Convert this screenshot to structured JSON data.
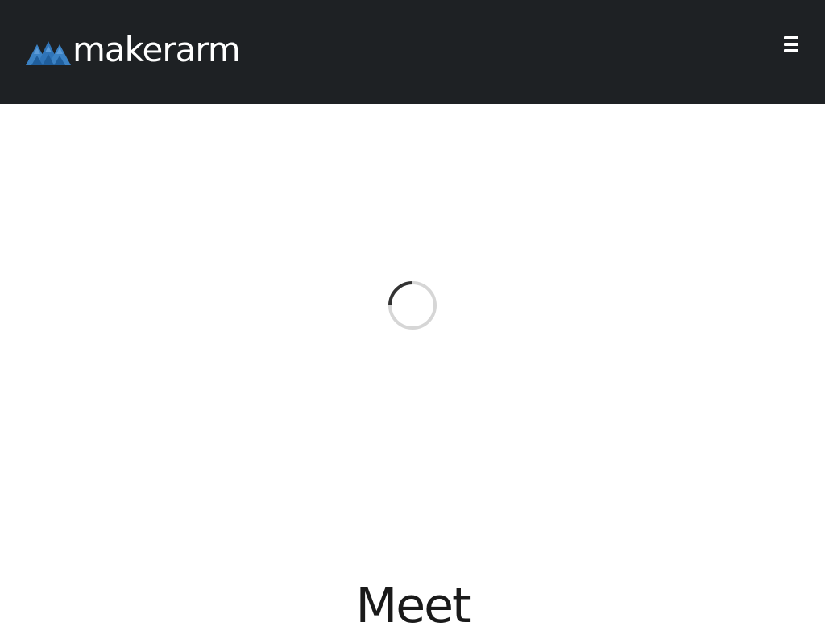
{
  "header": {
    "logo_text": "makerarm",
    "logo_icon": "mountain-triangles-icon",
    "menu_icon": "hamburger-menu-icon",
    "background_color": "#1e2124"
  },
  "main": {
    "spinner_icon": "loading-spinner-icon",
    "headline": "Meet"
  },
  "colors": {
    "logo_blue": "#3b82c4",
    "logo_blue_dark": "#1f5e9c",
    "spinner_track": "#d6d6d6",
    "spinner_arc": "#333333"
  }
}
